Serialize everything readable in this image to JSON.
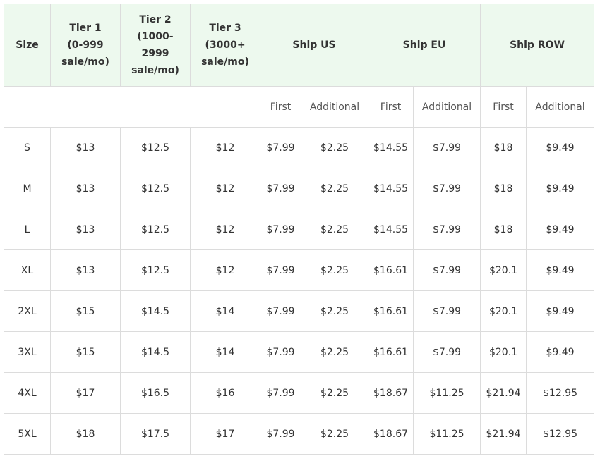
{
  "headers": {
    "size": "Size",
    "tier1": [
      "Tier 1",
      "(0-999",
      "sale/mo)"
    ],
    "tier2": [
      "Tier 2",
      "(1000-",
      "2999",
      "sale/mo)"
    ],
    "tier3": [
      "Tier 3",
      "(3000+",
      "sale/mo)"
    ],
    "ship_us": "Ship US",
    "ship_eu": "Ship EU",
    "ship_row": "Ship ROW"
  },
  "subheaders": [
    "First",
    "Additional",
    "First",
    "Additional",
    "First",
    "Additional"
  ],
  "rows": [
    [
      "S",
      "$13",
      "$12.5",
      "$12",
      "$7.99",
      "$2.25",
      "$14.55",
      "$7.99",
      "$18",
      "$9.49"
    ],
    [
      "M",
      "$13",
      "$12.5",
      "$12",
      "$7.99",
      "$2.25",
      "$14.55",
      "$7.99",
      "$18",
      "$9.49"
    ],
    [
      "L",
      "$13",
      "$12.5",
      "$12",
      "$7.99",
      "$2.25",
      "$14.55",
      "$7.99",
      "$18",
      "$9.49"
    ],
    [
      "XL",
      "$13",
      "$12.5",
      "$12",
      "$7.99",
      "$2.25",
      "$16.61",
      "$7.99",
      "$20.1",
      "$9.49"
    ],
    [
      "2XL",
      "$15",
      "$14.5",
      "$14",
      "$7.99",
      "$2.25",
      "$16.61",
      "$7.99",
      "$20.1",
      "$9.49"
    ],
    [
      "3XL",
      "$15",
      "$14.5",
      "$14",
      "$7.99",
      "$2.25",
      "$16.61",
      "$7.99",
      "$20.1",
      "$9.49"
    ],
    [
      "4XL",
      "$17",
      "$16.5",
      "$16",
      "$7.99",
      "$2.25",
      "$18.67",
      "$11.25",
      "$21.94",
      "$12.95"
    ],
    [
      "5XL",
      "$18",
      "$17.5",
      "$17",
      "$7.99",
      "$2.25",
      "$18.67",
      "$11.25",
      "$21.94",
      "$12.95"
    ]
  ]
}
